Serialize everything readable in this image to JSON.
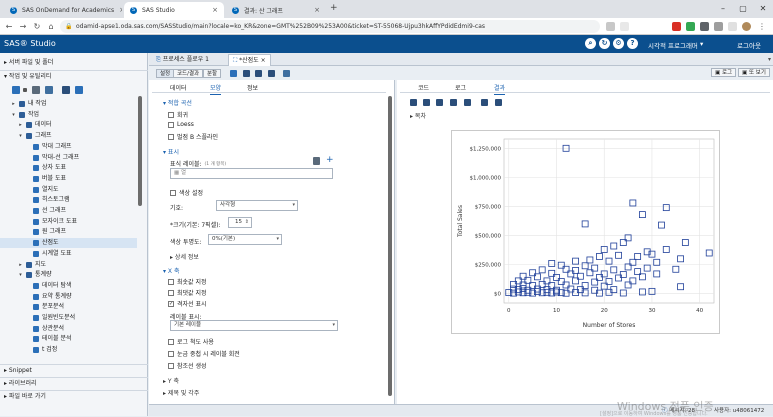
{
  "browser": {
    "tabs": [
      {
        "label": "SAS OnDemand for Academics"
      },
      {
        "label": "SAS Studio"
      },
      {
        "label": "결과: 산 그래프"
      }
    ],
    "new_tab": "+",
    "url": "odamid-apse1.oda.sas.com/SASStudio/main?locale=ko_KR&zone=GMT%252B09%253A00&ticket=ST-55068-Ujpu3hkAffYPdidEdmi9-cas"
  },
  "app": {
    "brand": "SAS® Studio",
    "visual_programmer": "시각적 프로그래머",
    "logout": "로그아웃"
  },
  "left": {
    "server_files": "서버 파일 및 폴더",
    "tasks_utilities": "작업 및 유틸리티",
    "tree": [
      {
        "label": "내 작업",
        "level": 0,
        "caret": "▸"
      },
      {
        "label": "작업",
        "level": 0,
        "caret": "▾"
      },
      {
        "label": "데이터",
        "level": 1,
        "caret": "▸"
      },
      {
        "label": "그래프",
        "level": 1,
        "caret": "▾"
      },
      {
        "label": "막대 그래프",
        "level": 2,
        "caret": ""
      },
      {
        "label": "막대-선 그래프",
        "level": 2,
        "caret": ""
      },
      {
        "label": "상자 도표",
        "level": 2,
        "caret": ""
      },
      {
        "label": "버블 도표",
        "level": 2,
        "caret": ""
      },
      {
        "label": "열지도",
        "level": 2,
        "caret": ""
      },
      {
        "label": "히스토그램",
        "level": 2,
        "caret": ""
      },
      {
        "label": "선 그래프",
        "level": 2,
        "caret": ""
      },
      {
        "label": "모자이크 도표",
        "level": 2,
        "caret": ""
      },
      {
        "label": "원 그래프",
        "level": 2,
        "caret": ""
      },
      {
        "label": "산점도",
        "level": 2,
        "caret": "",
        "selected": true
      },
      {
        "label": "시계열 도표",
        "level": 2,
        "caret": ""
      },
      {
        "label": "지도",
        "level": 1,
        "caret": "▸"
      },
      {
        "label": "통계량",
        "level": 1,
        "caret": "▾"
      },
      {
        "label": "데이터 탐색",
        "level": 2,
        "caret": ""
      },
      {
        "label": "요약 통계량",
        "level": 2,
        "caret": ""
      },
      {
        "label": "분포분석",
        "level": 2,
        "caret": ""
      },
      {
        "label": "일원빈도분석",
        "level": 2,
        "caret": ""
      },
      {
        "label": "상관분석",
        "level": 2,
        "caret": ""
      },
      {
        "label": "테이블 분석",
        "level": 2,
        "caret": ""
      },
      {
        "label": "t 검정",
        "level": 2,
        "caret": ""
      }
    ],
    "snippet": "Snippet",
    "libraries": "라이브러리",
    "file_shortcuts": "파일 바로 가기"
  },
  "main": {
    "tabs": [
      {
        "label": "프로세스 플로우 1"
      },
      {
        "label": "*산점도"
      }
    ],
    "subtabs": [
      "설정",
      "코드/결과",
      "분할"
    ],
    "view_buttons": [
      "로그",
      "또 보기"
    ]
  },
  "settings": {
    "tabs": [
      "데이터",
      "모양",
      "정보"
    ],
    "fit_curves": {
      "title": "적합 곡선",
      "items": [
        {
          "label": "회귀",
          "checked": false
        },
        {
          "label": "Loess",
          "checked": false
        },
        {
          "label": "벌점 B 스플라인",
          "checked": false
        }
      ]
    },
    "display": {
      "title": "표시",
      "marker_label": "표식 레이블:",
      "marker_label_hint": "(1 개 항목)",
      "marker_field_placeholder": "열",
      "color_setting": "색상 설정",
      "symbol_label": "기호:",
      "symbol_value": "사각형",
      "size_label": "*크기(기본: 7픽셀):",
      "size_value": "15",
      "transparency_label": "색상 투명도:",
      "transparency_value": "0%(기본)",
      "detail": "상세 정보"
    },
    "x_axis": {
      "title": "X 축",
      "items": [
        {
          "label": "최솟값 지정",
          "checked": false
        },
        {
          "label": "최댓값 지정",
          "checked": false
        },
        {
          "label": "격자선 표시",
          "checked": true
        }
      ],
      "label_display": "레이블 표시:",
      "label_display_value": "기본 레이블",
      "more": [
        {
          "label": "로그 척도 사용",
          "checked": false
        },
        {
          "label": "눈금 중첩 시 레이블 회전",
          "checked": false
        },
        {
          "label": "참조선 생성",
          "checked": false
        }
      ]
    },
    "y_axis": "Y 축",
    "legend": "제목 및 각주"
  },
  "results": {
    "tabs": [
      "코드",
      "로그",
      "결과"
    ],
    "section": "목차"
  },
  "chart_data": {
    "type": "scatter",
    "title": "",
    "xlabel": "Number of Stores",
    "ylabel": "Total Sales",
    "xlim": [
      -1,
      43
    ],
    "ylim": [
      -80000,
      1330000
    ],
    "xticks": [
      0,
      10,
      20,
      30,
      40
    ],
    "yticks": [
      0,
      250000,
      500000,
      750000,
      1000000,
      1250000
    ],
    "ytick_labels": [
      "$0",
      "$250,000",
      "$500,000",
      "$750,000",
      "$1,000,000",
      "$1,250,000"
    ],
    "grid": true,
    "marker": "square",
    "color": "#1f3f99",
    "points": [
      [
        12,
        1250000
      ],
      [
        26,
        780000
      ],
      [
        33,
        740000
      ],
      [
        28,
        680000
      ],
      [
        16,
        600000
      ],
      [
        32,
        590000
      ],
      [
        22,
        410000
      ],
      [
        25,
        480000
      ],
      [
        24,
        440000
      ],
      [
        37,
        440000
      ],
      [
        33,
        380000
      ],
      [
        29,
        360000
      ],
      [
        20,
        380000
      ],
      [
        36,
        300000
      ],
      [
        42,
        350000
      ],
      [
        30,
        340000
      ],
      [
        27,
        320000
      ],
      [
        19,
        320000
      ],
      [
        23,
        330000
      ],
      [
        31,
        270000
      ],
      [
        26,
        270000
      ],
      [
        21,
        280000
      ],
      [
        17,
        290000
      ],
      [
        14,
        280000
      ],
      [
        9,
        260000
      ],
      [
        11,
        245000
      ],
      [
        16,
        240000
      ],
      [
        25,
        230000
      ],
      [
        29,
        220000
      ],
      [
        35,
        210000
      ],
      [
        12,
        210000
      ],
      [
        18,
        220000
      ],
      [
        7,
        205000
      ],
      [
        22,
        205000
      ],
      [
        14,
        200000
      ],
      [
        27,
        190000
      ],
      [
        5,
        180000
      ],
      [
        9,
        175000
      ],
      [
        13,
        170000
      ],
      [
        17,
        180000
      ],
      [
        20,
        170000
      ],
      [
        24,
        165000
      ],
      [
        31,
        170000
      ],
      [
        3,
        150000
      ],
      [
        6,
        145000
      ],
      [
        10,
        140000
      ],
      [
        15,
        150000
      ],
      [
        19,
        140000
      ],
      [
        23,
        135000
      ],
      [
        28,
        145000
      ],
      [
        2,
        110000
      ],
      [
        4,
        115000
      ],
      [
        8,
        110000
      ],
      [
        11,
        105000
      ],
      [
        14,
        110000
      ],
      [
        18,
        100000
      ],
      [
        21,
        105000
      ],
      [
        26,
        110000
      ],
      [
        1,
        80000
      ],
      [
        3,
        75000
      ],
      [
        5,
        70000
      ],
      [
        7,
        80000
      ],
      [
        9,
        70000
      ],
      [
        12,
        75000
      ],
      [
        16,
        70000
      ],
      [
        20,
        65000
      ],
      [
        25,
        75000
      ],
      [
        1,
        40000
      ],
      [
        2,
        35000
      ],
      [
        3,
        45000
      ],
      [
        4,
        30000
      ],
      [
        6,
        40000
      ],
      [
        8,
        35000
      ],
      [
        10,
        30000
      ],
      [
        13,
        40000
      ],
      [
        15,
        35000
      ],
      [
        18,
        30000
      ],
      [
        22,
        35000
      ],
      [
        0,
        10000
      ],
      [
        1,
        5000
      ],
      [
        2,
        15000
      ],
      [
        3,
        8000
      ],
      [
        4,
        12000
      ],
      [
        5,
        5000
      ],
      [
        6,
        18000
      ],
      [
        7,
        8000
      ],
      [
        8,
        12000
      ],
      [
        9,
        6000
      ],
      [
        10,
        15000
      ],
      [
        11,
        9000
      ],
      [
        12,
        4000
      ],
      [
        14,
        10000
      ],
      [
        16,
        7000
      ],
      [
        19,
        5000
      ],
      [
        21,
        12000
      ],
      [
        24,
        6000
      ],
      [
        28,
        15000
      ],
      [
        30,
        20000
      ],
      [
        36,
        60000
      ]
    ]
  },
  "status": {
    "messages": "메시지: 28",
    "user": "사용자: u48061472"
  },
  "watermark": {
    "line1": "Windows 정품 인증",
    "line2": "[설정]으로 이동하여 Windows를 정품 인증합니다."
  }
}
